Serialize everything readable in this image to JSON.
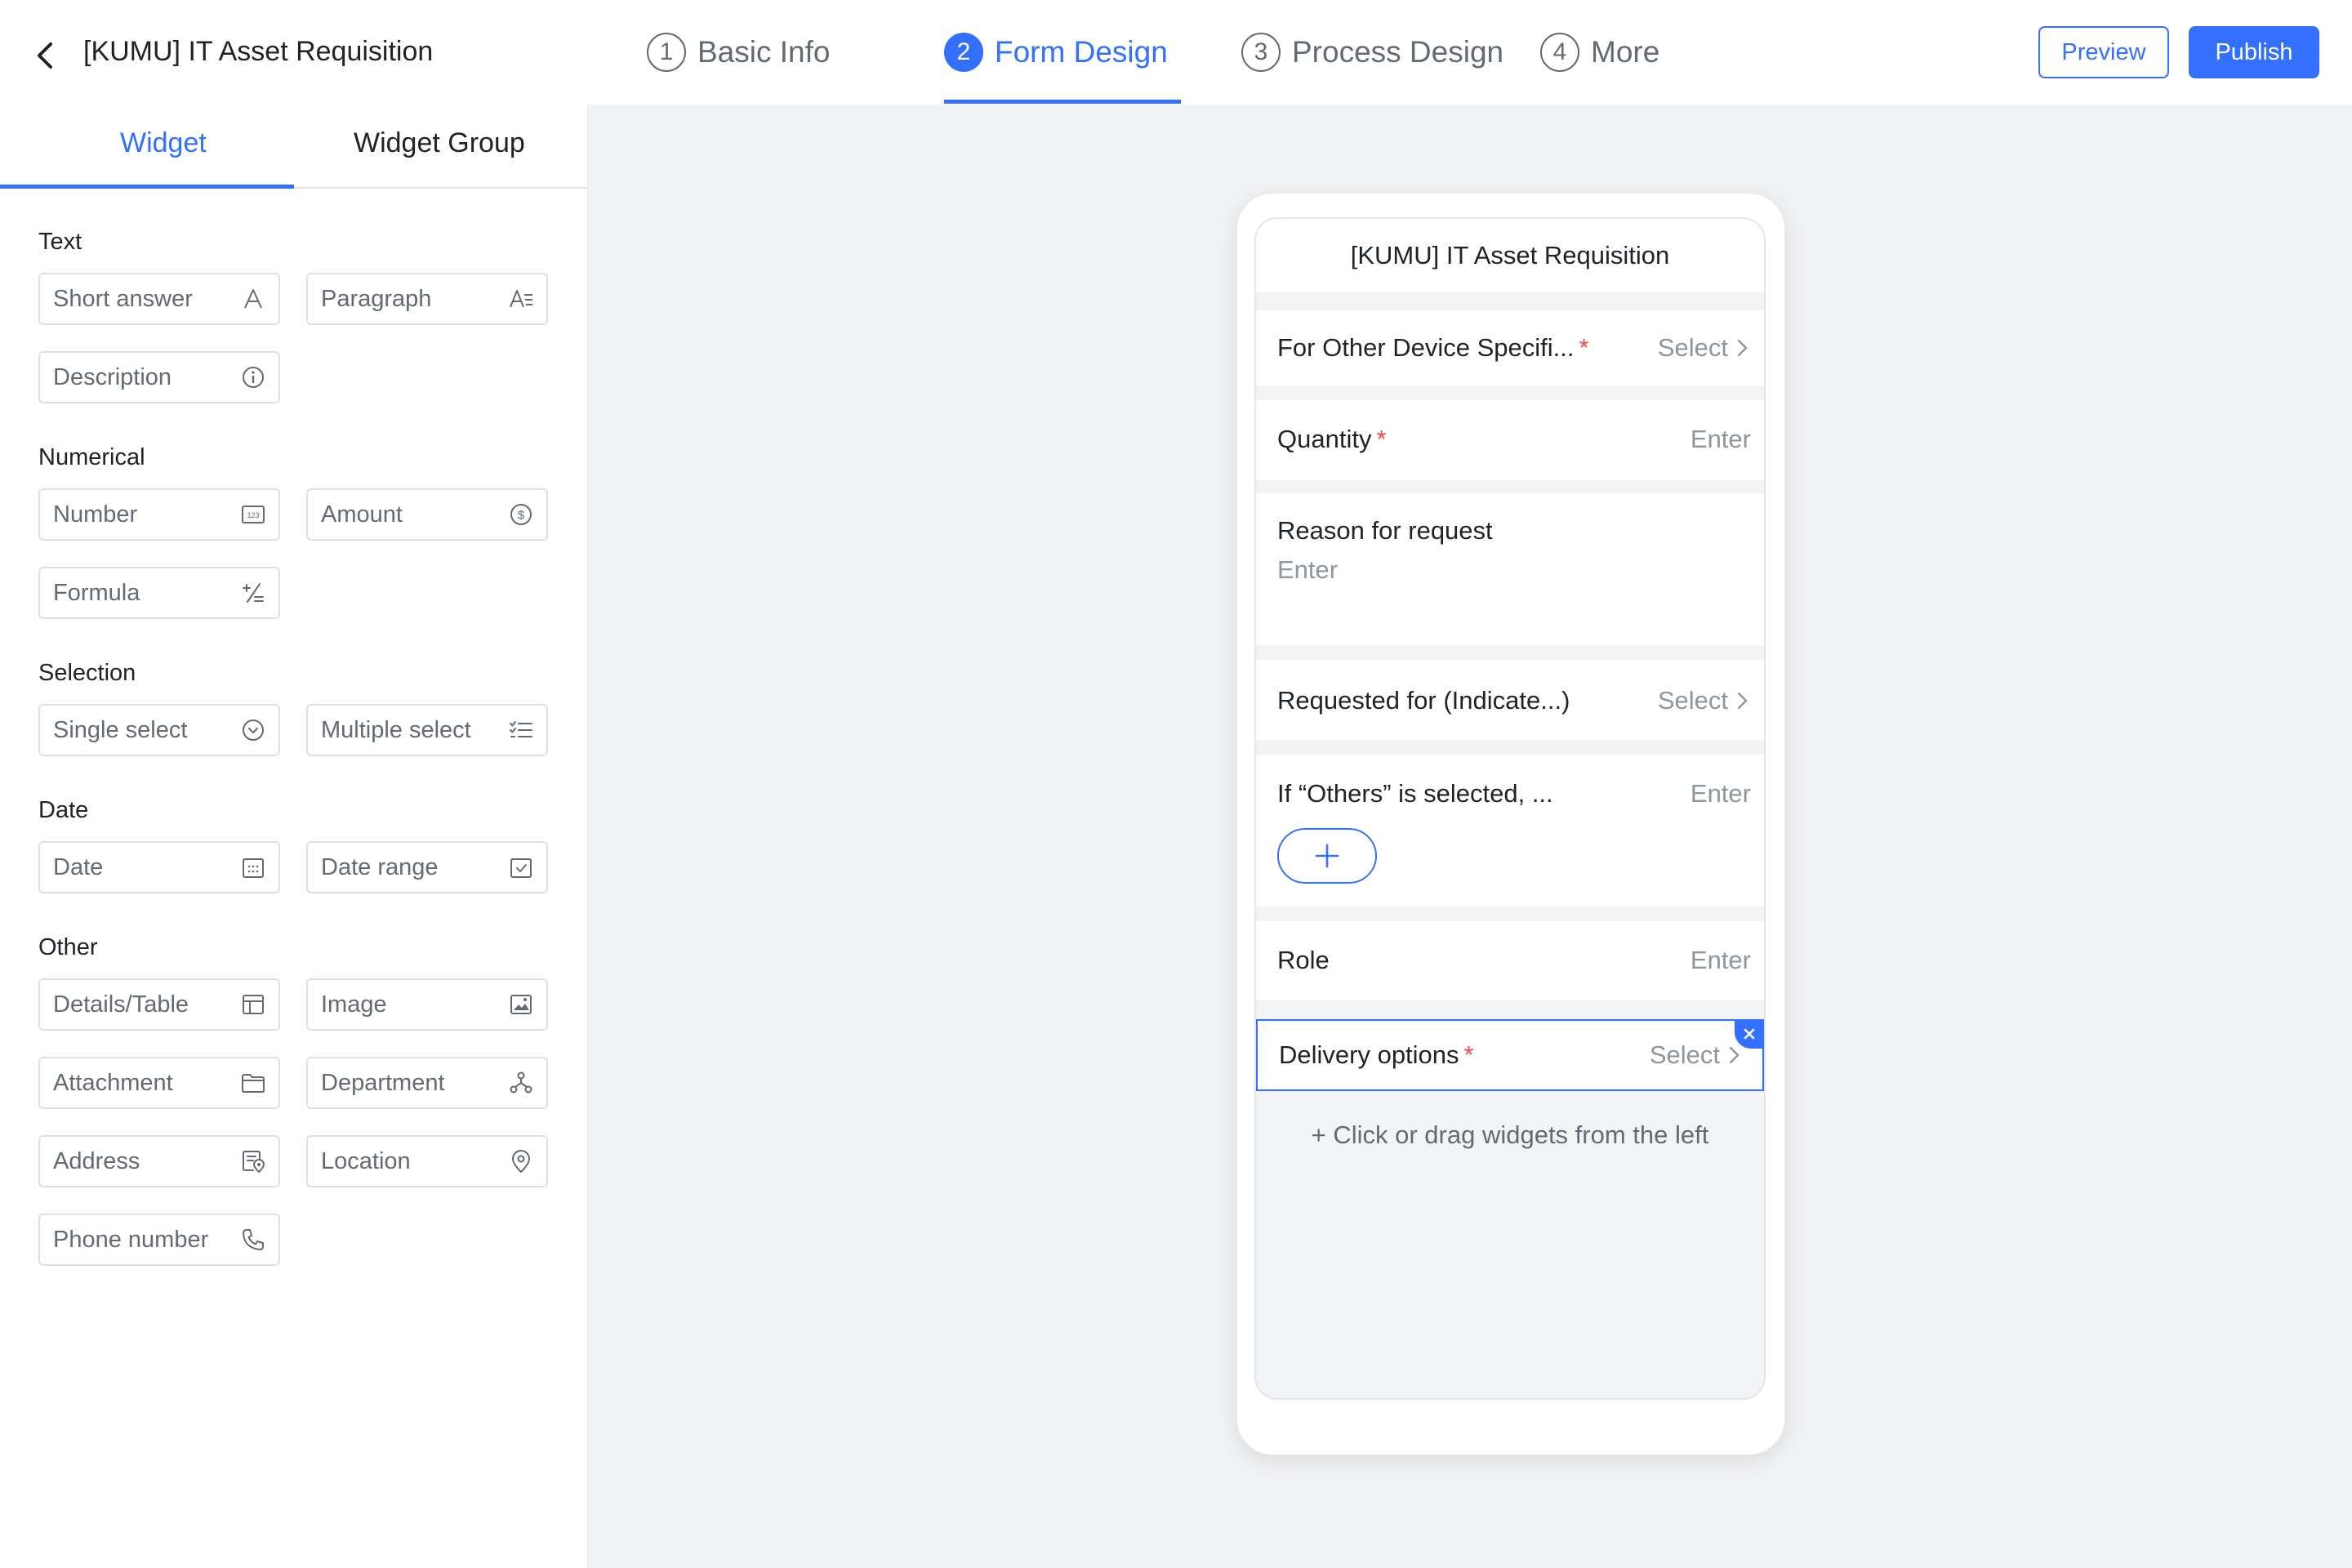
{
  "header": {
    "title": "[KUMU] IT Asset Requisition",
    "steps": [
      {
        "num": "1",
        "label": "Basic Info"
      },
      {
        "num": "2",
        "label": "Form Design"
      },
      {
        "num": "3",
        "label": "Process Design"
      },
      {
        "num": "4",
        "label": "More"
      }
    ],
    "active_step": "Form Design",
    "preview_label": "Preview",
    "publish_label": "Publish"
  },
  "sidebar": {
    "tabs": [
      "Widget",
      "Widget Group"
    ],
    "active_tab": "Widget",
    "sections": {
      "text": {
        "title": "Text",
        "items": [
          {
            "label": "Short answer",
            "icon": "short-answer-icon"
          },
          {
            "label": "Paragraph",
            "icon": "paragraph-icon"
          },
          {
            "label": "Description",
            "icon": "info-icon"
          }
        ]
      },
      "numerical": {
        "title": "Numerical",
        "items": [
          {
            "label": "Number",
            "icon": "number-icon"
          },
          {
            "label": "Amount",
            "icon": "dollar-icon"
          },
          {
            "label": "Formula",
            "icon": "formula-icon"
          }
        ]
      },
      "selection": {
        "title": "Selection",
        "items": [
          {
            "label": "Single select",
            "icon": "chevron-circle-icon"
          },
          {
            "label": "Multiple select",
            "icon": "checklist-icon"
          }
        ]
      },
      "date": {
        "title": "Date",
        "items": [
          {
            "label": "Date",
            "icon": "calendar-icon"
          },
          {
            "label": "Date range",
            "icon": "calendar-check-icon"
          }
        ]
      },
      "other": {
        "title": "Other",
        "items": [
          {
            "label": "Details/Table",
            "icon": "table-icon"
          },
          {
            "label": "Image",
            "icon": "image-icon"
          },
          {
            "label": "Attachment",
            "icon": "folder-icon"
          },
          {
            "label": "Department",
            "icon": "org-chart-icon"
          },
          {
            "label": "Address",
            "icon": "address-icon"
          },
          {
            "label": "Location",
            "icon": "location-pin-icon"
          },
          {
            "label": "Phone number",
            "icon": "phone-icon"
          }
        ]
      }
    }
  },
  "form": {
    "title": "[KUMU] IT Asset Requisition",
    "fields": [
      {
        "label": "For Other Device Specifi...",
        "required": true,
        "value": "Select",
        "type": "select"
      },
      {
        "label": "Quantity",
        "required": true,
        "value": "Enter",
        "type": "input"
      },
      {
        "label": "Reason for request",
        "required": false,
        "value": "Enter",
        "type": "textarea"
      },
      {
        "label": "Requested for (Indicate...)",
        "required": false,
        "value": "Select",
        "type": "select"
      },
      {
        "label": "If “Others” is selected, ...",
        "required": false,
        "value": "Enter",
        "type": "input-add"
      },
      {
        "label": "Role",
        "required": false,
        "value": "Enter",
        "type": "input"
      },
      {
        "label": "Delivery options",
        "required": true,
        "value": "Select",
        "type": "select",
        "selected": true
      }
    ],
    "required_mark": "*",
    "drop_hint": "+ Click or drag widgets from the left"
  },
  "colors": {
    "accent": "#3370ff",
    "required": "#f54a45",
    "canvas_bg": "#f0f1f3",
    "text_secondary": "#8f959e"
  }
}
